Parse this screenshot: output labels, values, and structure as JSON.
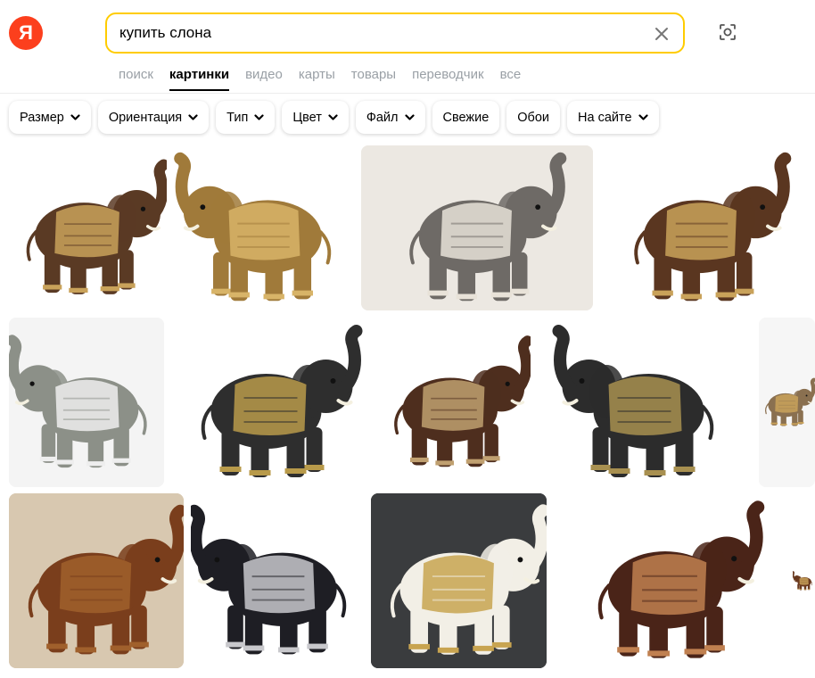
{
  "logo": {
    "letter": "Я"
  },
  "search": {
    "query": "купить слона"
  },
  "nav": [
    {
      "label": "поиск"
    },
    {
      "label": "картинки"
    },
    {
      "label": "видео"
    },
    {
      "label": "карты"
    },
    {
      "label": "товары"
    },
    {
      "label": "переводчик"
    },
    {
      "label": "все"
    }
  ],
  "filters": [
    {
      "label": "Размер",
      "dropdown": true
    },
    {
      "label": "Ориентация",
      "dropdown": true
    },
    {
      "label": "Тип",
      "dropdown": true
    },
    {
      "label": "Цвет",
      "dropdown": true
    },
    {
      "label": "Файл",
      "dropdown": true
    },
    {
      "label": "Свежие",
      "dropdown": false
    },
    {
      "label": "Обои",
      "dropdown": false
    },
    {
      "label": "На сайте",
      "dropdown": true
    }
  ],
  "colors": {
    "accent": "#ffcc00",
    "logo": "#fc3f1d"
  },
  "images": [
    {
      "name": "brown elephant figurine with mirror saddle",
      "body": "#5a3a24",
      "deco": "#c9a25a",
      "bg": "#ffffff"
    },
    {
      "name": "bronze elephant figurine",
      "body": "#a07a3a",
      "deco": "#d8b468",
      "bg": "#ffffff"
    },
    {
      "name": "baby elephant lying on bed",
      "body": "#6e6a66",
      "deco": "#e8e2d8",
      "bg": "#ece8e2"
    },
    {
      "name": "brown elephant with baby",
      "body": "#5a3620",
      "deco": "#c9a25a",
      "bg": "#ffffff"
    },
    {
      "name": "grey elephant holding flower",
      "body": "#8c9088",
      "deco": "#eeeeee",
      "bg": "#f4f4f4"
    },
    {
      "name": "black elephant with golden saddle",
      "body": "#2e2e2e",
      "deco": "#b89a4a",
      "bg": "#ffffff"
    },
    {
      "name": "brown elephant with checkered saddle",
      "body": "#4e2e1e",
      "deco": "#c0a070",
      "bg": "#ffffff"
    },
    {
      "name": "black elephant with ornate blanket",
      "body": "#2c2c2c",
      "deco": "#a89050",
      "bg": "#ffffff"
    },
    {
      "name": "partial elephant figurine",
      "body": "#8a7050",
      "deco": "#c9a25a",
      "bg": "#f6f6f6"
    },
    {
      "name": "carved wooden elephant in shop",
      "body": "#7a3e1c",
      "deco": "#a0602c",
      "bg": "#d8c8b0"
    },
    {
      "name": "black and silver elephant",
      "body": "#1e1e24",
      "deco": "#c8c8cc",
      "bg": "#ffffff"
    },
    {
      "name": "white elephant stool",
      "body": "#f2efe6",
      "deco": "#c8a450",
      "bg": "#3a3c3e"
    },
    {
      "name": "brown elephant stool",
      "body": "#4a2418",
      "deco": "#c08050",
      "bg": "#ffffff"
    },
    {
      "name": "partial elephant",
      "body": "#6a3a20",
      "deco": "#c9a25a",
      "bg": "#ffffff"
    }
  ]
}
